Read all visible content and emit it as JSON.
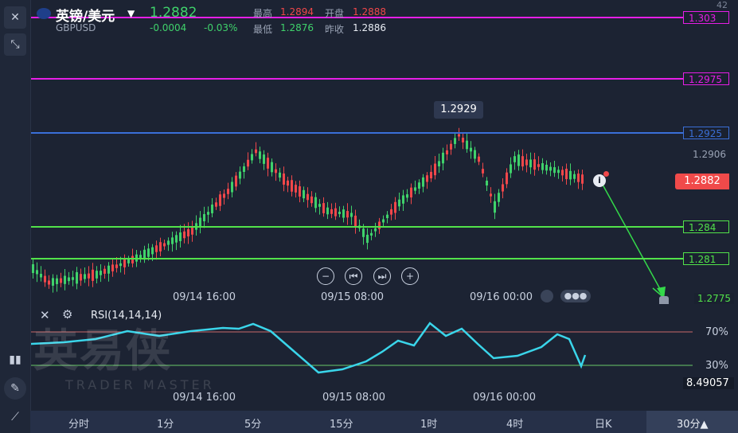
{
  "header": {
    "symbol_name": "英镑/美元",
    "symbol_code": "GBPUSD",
    "price": "1.2882",
    "change": "-0.0004",
    "change_pct": "-0.03%",
    "high_label": "最高",
    "high_value": "1.2894",
    "open_label": "开盘",
    "open_value": "1.2888",
    "low_label": "最低",
    "low_value": "1.2876",
    "prev_close_label": "昨收",
    "prev_close_value": "1.2886",
    "top_axis_partial": "42"
  },
  "price_lines": [
    {
      "label": "1.303",
      "color": "#e61ee6"
    },
    {
      "label": "1.2975",
      "color": "#e61ee6"
    },
    {
      "label": "1.2925",
      "color": "#3a6fd8"
    },
    {
      "label": "1.284",
      "color": "#52e24a"
    },
    {
      "label": "1.281",
      "color": "#52e24a"
    }
  ],
  "axis_labels": {
    "a": "1.2906",
    "current": "1.2882",
    "bottom": "1.2775"
  },
  "tooltip": "1.2929",
  "x_axis": [
    "09/14 16:00",
    "09/15 08:00",
    "09/16 00:00"
  ],
  "rsi": {
    "title": "RSI(14,14,14)",
    "level_high": "70%",
    "level_low": "30%",
    "value": "8.49057"
  },
  "watermark": {
    "brand": "英易侠",
    "sub": "TRADER MASTER"
  },
  "timeframes": [
    "分时",
    "1分",
    "5分",
    "15分",
    "1时",
    "4时",
    "日K",
    "30分▲"
  ],
  "colors": {
    "up": "#f0474a",
    "down": "#3fd26b",
    "rsi": "#3ad5ea",
    "bg": "#1c2333"
  }
}
